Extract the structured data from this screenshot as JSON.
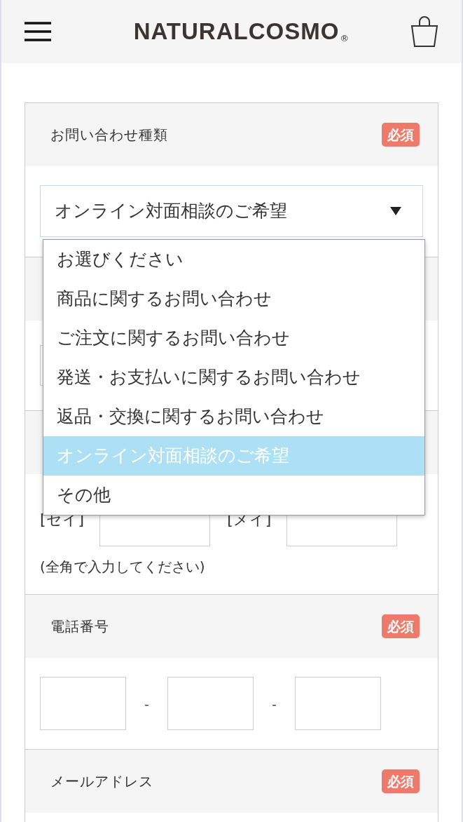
{
  "header": {
    "logo": "NATURALCOSMO",
    "logo_mark": "®"
  },
  "sections": [
    {
      "kind": "select",
      "label": "お問い合わせ種類",
      "badge": "必須",
      "value": "オンライン対面相談のご希望"
    },
    {
      "kind": "text"
    },
    {
      "kind": "name",
      "fields": [
        {
          "label": "[セイ]"
        },
        {
          "label": "[メイ]"
        }
      ],
      "note": "(全角で入力してください)"
    },
    {
      "kind": "phone",
      "label": "電話番号",
      "badge": "必須",
      "separators": [
        "-",
        "-"
      ]
    },
    {
      "kind": "email",
      "label": "メールアドレス",
      "badge": "必須"
    }
  ],
  "dropdown": {
    "options": [
      {
        "label": "お選びください",
        "selected": false
      },
      {
        "label": "商品に関するお問い合わせ",
        "selected": false
      },
      {
        "label": "ご注文に関するお問い合わせ",
        "selected": false
      },
      {
        "label": "発送・お支払いに関するお問い合わせ",
        "selected": false
      },
      {
        "label": "返品・交換に関するお問い合わせ",
        "selected": false
      },
      {
        "label": "オンライン対面相談のご希望",
        "selected": true
      },
      {
        "label": "その他",
        "selected": false
      }
    ]
  }
}
